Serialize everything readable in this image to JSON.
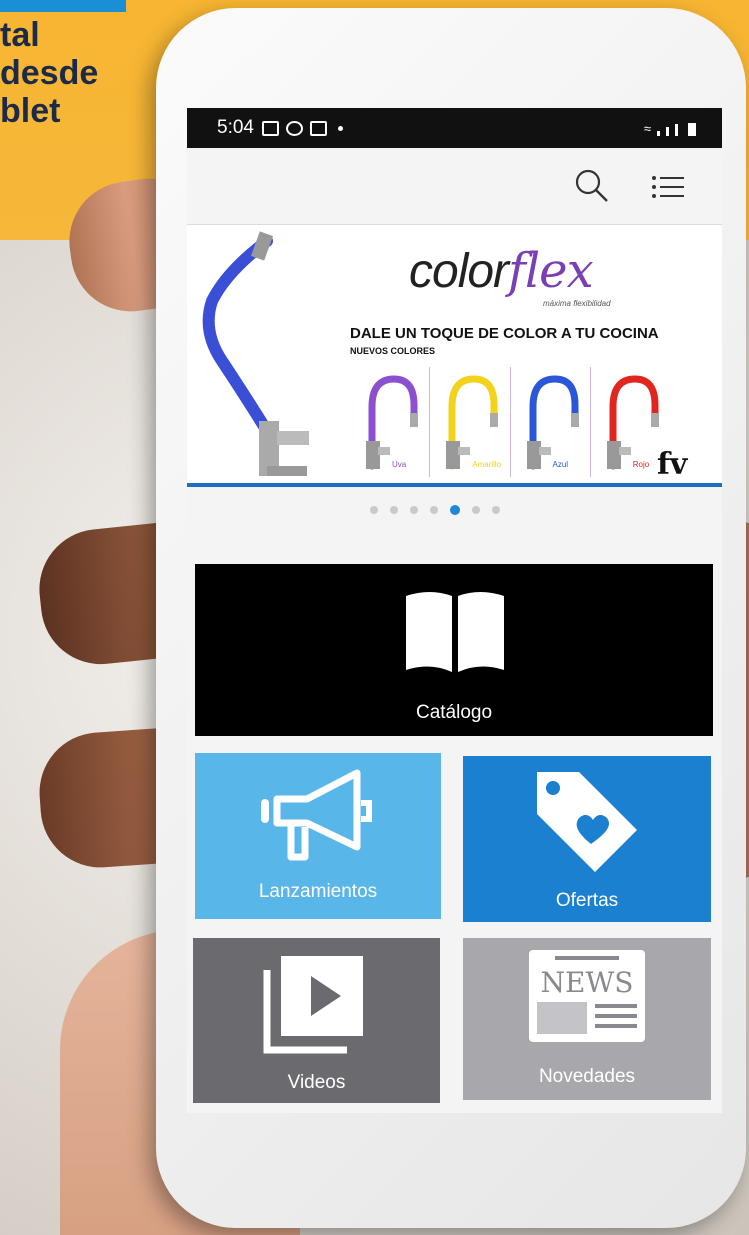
{
  "promo": {
    "text": "tal\n desde\nblet"
  },
  "status_bar": {
    "time": "5:04"
  },
  "banner": {
    "brand_left": "color",
    "brand_right": "flex",
    "brand_tagline": "máxima flexibilidad",
    "headline": "DALE UN TOQUE DE COLOR A TU COCINA",
    "subheadline": "NUEVOS COLORES",
    "swatches": [
      {
        "label": "Uva",
        "color": "#8b4fd0"
      },
      {
        "label": "Amarillo",
        "color": "#f2d21b"
      },
      {
        "label": "Azul",
        "color": "#2a56d8"
      },
      {
        "label": "Rojo",
        "color": "#e0261f"
      }
    ],
    "logo": "fv",
    "carousel_count": 7,
    "carousel_active": 5
  },
  "tiles": {
    "catalogo": "Catálogo",
    "lanzamientos": "Lanzamientos",
    "ofertas": "Ofertas",
    "videos": "Videos",
    "novedades": "Novedades",
    "news_icon_text": "NEWS"
  },
  "colors": {
    "catalogo_bg": "#000000",
    "lanzamientos_bg": "#58b6e8",
    "ofertas_bg": "#1a80cf",
    "videos_bg": "#6b6b6f",
    "novedades_bg": "#a8a8ac",
    "accent_line": "#1f6fc0"
  },
  "icons": {
    "search": "search-icon",
    "menu": "list-menu-icon",
    "catalog": "open-book-icon",
    "launches": "megaphone-icon",
    "offers": "price-tag-heart-icon",
    "videos": "video-play-icon",
    "news": "newspaper-icon"
  }
}
